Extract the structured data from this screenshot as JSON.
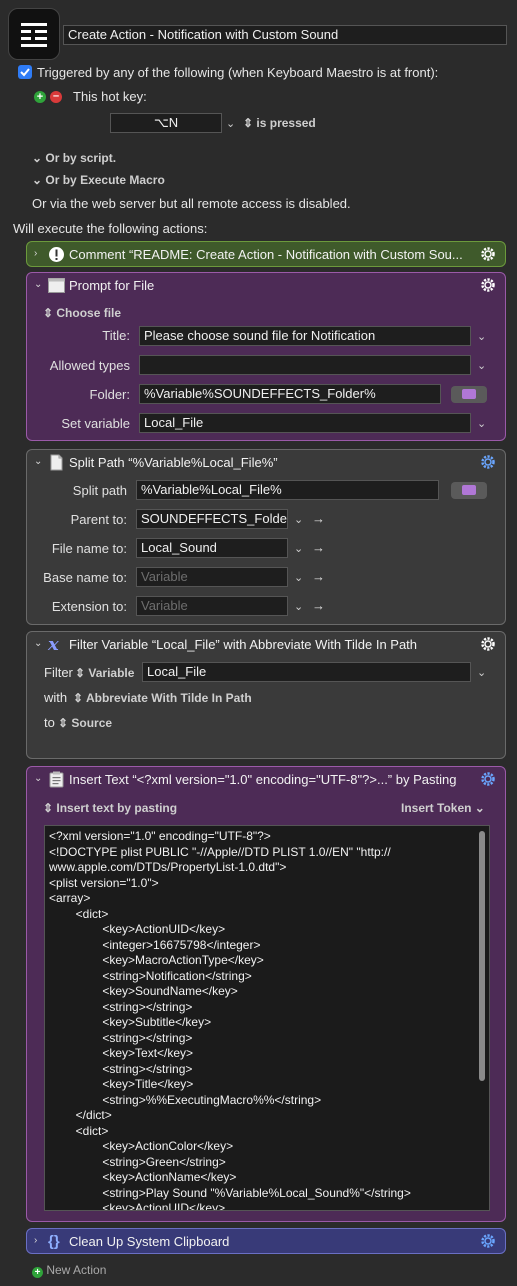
{
  "macro": {
    "name": "Create Action - Notification with Custom Sound",
    "trigger_text": "Triggered by any of the following (when Keyboard Maestro is at front):",
    "hotkey_label": "This hot key:",
    "hotkey_value": "⌥N",
    "hotkey_state": "is pressed",
    "or_script": "Or by script.",
    "or_execute": "Or by Execute Macro",
    "web_server": "Or via the web server but all remote access is disabled.",
    "will_execute": "Will execute the following actions:"
  },
  "actions": {
    "comment": {
      "title": "Comment “README: Create Action - Notification with Custom Sou..."
    },
    "prompt": {
      "title": "Prompt for File",
      "mode": "Choose file",
      "title_label": "Title:",
      "title_value": "Please choose sound file for Notification",
      "allowed_label": "Allowed types",
      "allowed_value": "",
      "folder_label": "Folder:",
      "folder_value": "%Variable%SOUNDEFFECTS_Folder%",
      "setvar_label": "Set variable",
      "setvar_value": "Local_File"
    },
    "split": {
      "title": "Split Path “%Variable%Local_File%”",
      "split_label": "Split path",
      "split_value": "%Variable%Local_File%",
      "parent_label": "Parent to:",
      "parent_value": "SOUNDEFFECTS_Folder",
      "filename_label": "File name to:",
      "filename_value": "Local_Sound",
      "basename_label": "Base name to:",
      "basename_value": "Variable",
      "ext_label": "Extension to:",
      "ext_value": "Variable"
    },
    "filter": {
      "title": "Filter Variable “Local_File” with Abbreviate With Tilde In Path",
      "filter_label": "Filter",
      "filter_type": "Variable",
      "filter_value": "Local_File",
      "with_label": "with",
      "with_value": "Abbreviate With Tilde In Path",
      "to_label": "to",
      "to_value": "Source"
    },
    "insert": {
      "title": "Insert Text “<?xml version=\"1.0\" encoding=\"UTF-8\"?>...” by Pasting",
      "mode": "Insert text by pasting",
      "token": "Insert Token",
      "code": "<?xml version=\"1.0\" encoding=\"UTF-8\"?>\n<!DOCTYPE plist PUBLIC \"-//Apple//DTD PLIST 1.0//EN\" \"http://\nwww.apple.com/DTDs/PropertyList-1.0.dtd\">\n<plist version=\"1.0\">\n<array>\n        <dict>\n                <key>ActionUID</key>\n                <integer>16675798</integer>\n                <key>MacroActionType</key>\n                <string>Notification</string>\n                <key>SoundName</key>\n                <string></string>\n                <key>Subtitle</key>\n                <string></string>\n                <key>Text</key>\n                <string></string>\n                <key>Title</key>\n                <string>%%ExecutingMacro%%</string>\n        </dict>\n        <dict>\n                <key>ActionColor</key>\n                <string>Green</string>\n                <key>ActionName</key>\n                <string>Play Sound \"%Variable%Local_Sound%\"</string>\n                <key>ActionUID</key>"
    },
    "cleanup": {
      "title": "Clean Up System Clipboard"
    }
  },
  "footer": {
    "new_action": "New Action"
  },
  "colors": {
    "comment_bg": "#3f5a2b",
    "comment_border": "#6c9a3c",
    "purple_bg": "#4d2b56",
    "purple_border": "#9b5aa8",
    "gray_bg": "#3a3a3a",
    "cleanup_bg": "#383a78",
    "cleanup_border": "#6a6fc4",
    "checkbox_blue": "#2f7cf6"
  }
}
